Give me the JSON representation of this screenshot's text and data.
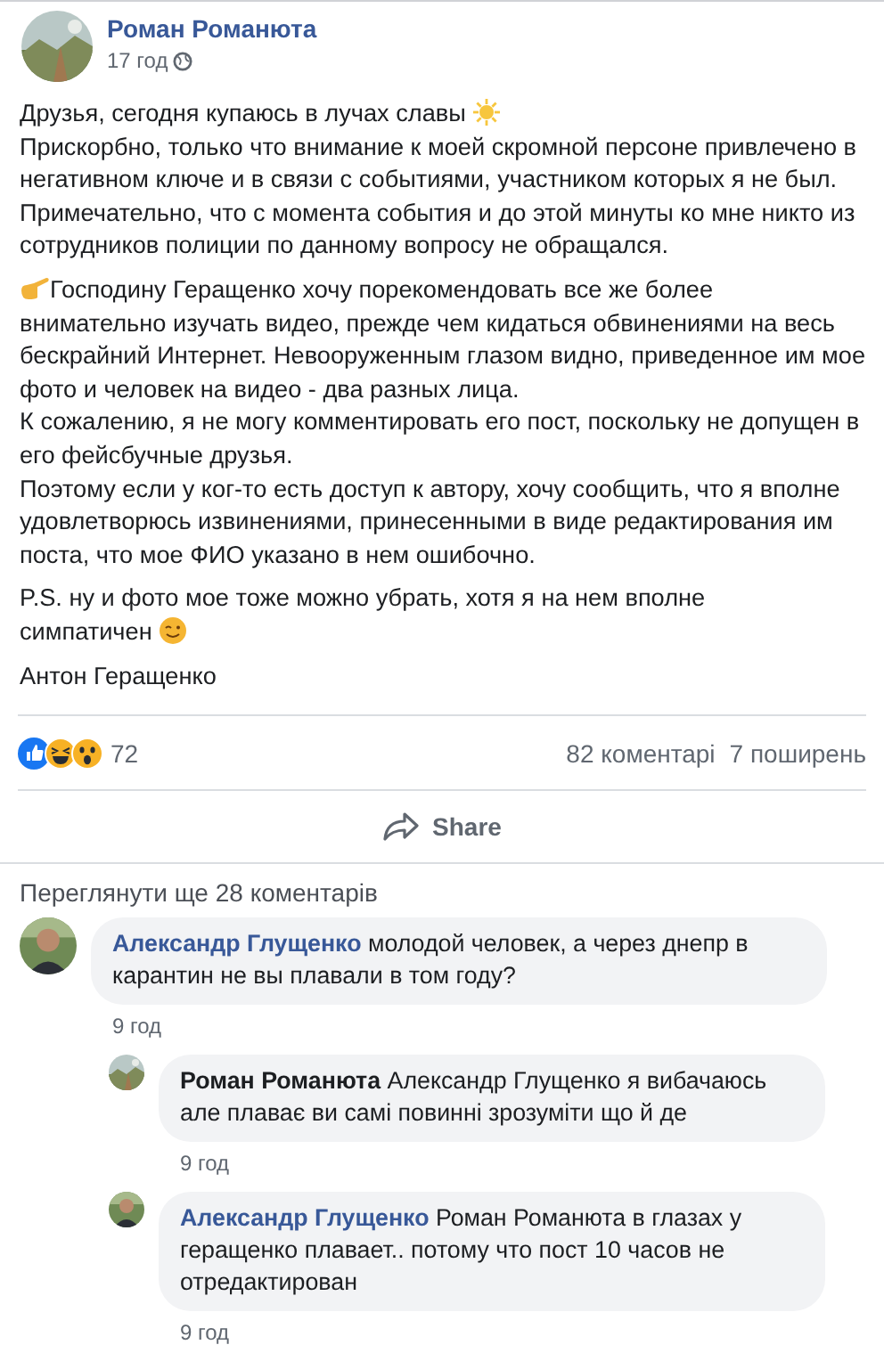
{
  "post": {
    "author": "Роман Романюта",
    "time": "17 год",
    "paragraphs": [
      {
        "lines": [
          {
            "text": "Друзья, сегодня купаюсь в лучах славы",
            "kind": "sun_after"
          },
          {
            "text": "Прискорбно, только что внимание к моей скромной персоне привлечено в негативном ключе и в связи с событиями, участником которых я не был.",
            "kind": "plain"
          },
          {
            "text": "Примечательно, что с момента события и до этой минуты ко мне никто из сотрудников полиции по данному вопросу не обращался.",
            "kind": "plain"
          }
        ]
      },
      {
        "lines": [
          {
            "text": "Господину Геращенко хочу порекомендовать все же более",
            "kind": "hand_before"
          },
          {
            "text": "внимательно изучать видео, прежде чем кидаться обвинениями на весь бескрайний Интернет. Невооруженным глазом видно, приведенное им мое фото и человек на видео - два разных лица.",
            "kind": "plain"
          },
          {
            "text": "К сожалению, я не могу комментировать его пост, поскольку не допущен в его фейсбучные друзья.",
            "kind": "plain"
          },
          {
            "text": "Поэтому если у ког-то есть доступ к автору, хочу сообщить, что я вполне удовлетворюсь извинениями, принесенными в виде редактирования им поста, что мое ФИО указано в нем ошибочно.",
            "kind": "plain"
          }
        ]
      },
      {
        "lines": [
          {
            "text": "P.S. ну и фото мое тоже можно убрать, хотя я на нем вполне",
            "kind": "plain"
          },
          {
            "text": "симпатичен",
            "kind": "wink_after"
          }
        ]
      },
      {
        "lines": [
          {
            "text": "Антон Геращенко",
            "kind": "plain"
          }
        ]
      }
    ],
    "reactions": {
      "types": [
        {
          "kind": "like"
        },
        {
          "kind": "haha"
        },
        {
          "kind": "wow"
        }
      ],
      "count": "72"
    },
    "comments_count": "82 коментарі",
    "shares_count": "7 поширень",
    "share_label": "Share"
  },
  "more_comments": "Переглянути ще 28 коментарів",
  "comments": [
    {
      "author": "Александр Глущенко",
      "is_post_author": false,
      "text": "молодой человек, а через днепр в карантин не вы плавали в том году?",
      "time": "9 год",
      "replies": [
        {
          "author": "Роман Романюта",
          "is_post_author": true,
          "text": "Александр Глущенко я вибачаюсь але плаває ви самі повинні зрозуміти що й де",
          "time": "9 год"
        },
        {
          "author": "Александр Глущенко",
          "is_post_author": false,
          "text": "Роман Романюта в глазах у геращенко плавает.. потому что пост 10 часов не отредактирован",
          "time": "9 год"
        }
      ]
    }
  ]
}
